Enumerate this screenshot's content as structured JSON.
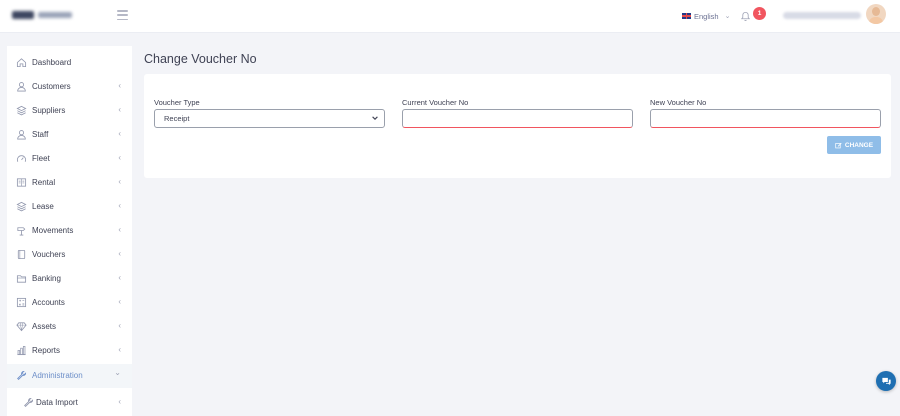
{
  "header": {
    "language": {
      "label": "English"
    },
    "notifications": {
      "count": "1"
    }
  },
  "sidebar": {
    "items": [
      {
        "label": "Dashboard",
        "icon": "home-icon"
      },
      {
        "label": "Customers",
        "icon": "user-icon"
      },
      {
        "label": "Suppliers",
        "icon": "layers-icon"
      },
      {
        "label": "Staff",
        "icon": "user-icon"
      },
      {
        "label": "Fleet",
        "icon": "gauge-icon"
      },
      {
        "label": "Rental",
        "icon": "book-icon"
      },
      {
        "label": "Lease",
        "icon": "layers-icon"
      },
      {
        "label": "Movements",
        "icon": "route-icon"
      },
      {
        "label": "Vouchers",
        "icon": "document-icon"
      },
      {
        "label": "Banking",
        "icon": "folder-icon"
      },
      {
        "label": "Accounts",
        "icon": "calculator-icon"
      },
      {
        "label": "Assets",
        "icon": "diamond-icon"
      },
      {
        "label": "Reports",
        "icon": "bar-chart-icon"
      },
      {
        "label": "Administration",
        "icon": "wrench-icon"
      },
      {
        "label": "Data Import",
        "icon": "wrench-icon"
      }
    ],
    "chevron_collapsed": "‹",
    "chevron_expanded": "⌄"
  },
  "main": {
    "title": "Change Voucher No",
    "form": {
      "voucher_type": {
        "label": "Voucher Type",
        "value": "Receipt"
      },
      "current_voucher_no": {
        "label": "Current Voucher No",
        "value": ""
      },
      "new_voucher_no": {
        "label": "New Voucher No",
        "value": ""
      },
      "change_button": {
        "label": "CHANGE"
      }
    }
  },
  "colors": {
    "accent": "#6c8ec8",
    "button": "#8fbde8",
    "error_underline": "#f1555f",
    "chat_button": "#1f6fb2"
  }
}
